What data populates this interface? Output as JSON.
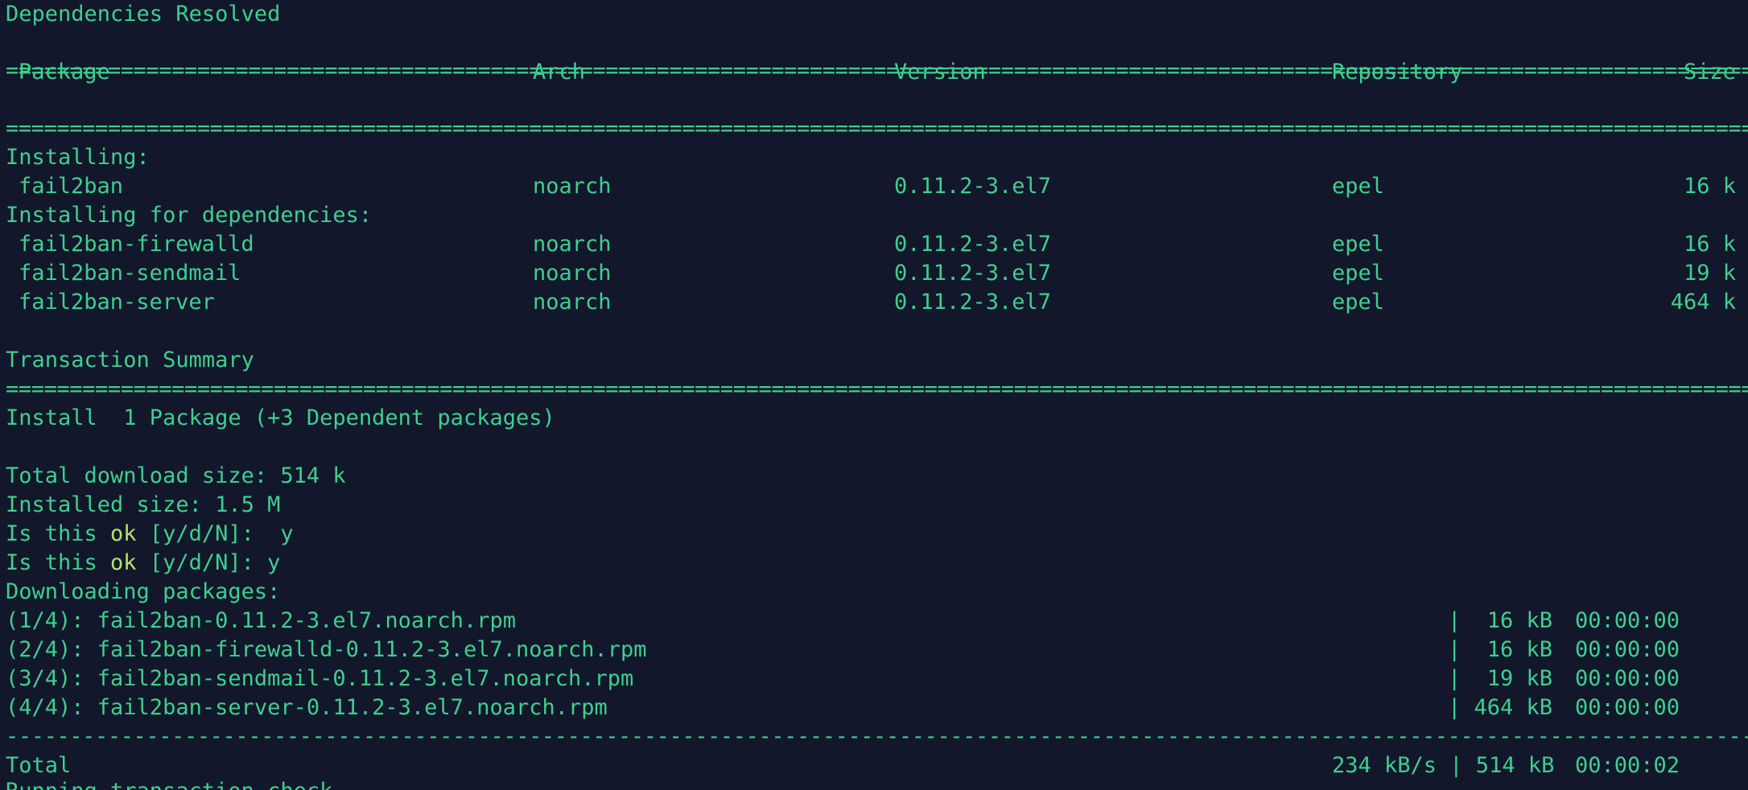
{
  "terminal": {
    "heading": "Dependencies Resolved",
    "table_header": {
      "package": "Package",
      "arch": "Arch",
      "version": "Version",
      "repository": "Repository",
      "size": "Size"
    },
    "installing_label": "Installing:",
    "installing": [
      {
        "name": "fail2ban",
        "arch": "noarch",
        "version": "0.11.2-3.el7",
        "repo": "epel",
        "size": "16 k"
      }
    ],
    "deps_label": "Installing for dependencies:",
    "dependencies": [
      {
        "name": "fail2ban-firewalld",
        "arch": "noarch",
        "version": "0.11.2-3.el7",
        "repo": "epel",
        "size": "16 k"
      },
      {
        "name": "fail2ban-sendmail",
        "arch": "noarch",
        "version": "0.11.2-3.el7",
        "repo": "epel",
        "size": "19 k"
      },
      {
        "name": "fail2ban-server",
        "arch": "noarch",
        "version": "0.11.2-3.el7",
        "repo": "epel",
        "size": "464 k"
      }
    ],
    "summary_title": "Transaction Summary",
    "install_line": "Install  1 Package (+3 Dependent packages)",
    "total_download": "Total download size: 514 k",
    "installed_size": "Installed size: 1.5 M",
    "prompt1": {
      "prefix": "Is this ",
      "ok": "ok",
      "suffix": " [y/d/N]:  y"
    },
    "prompt2": {
      "prefix": "Is this ",
      "ok": "ok",
      "suffix": " [y/d/N]: y"
    },
    "downloading_label": "Downloading packages:",
    "downloads": [
      {
        "file": "(1/4): fail2ban-0.11.2-3.el7.noarch.rpm",
        "size": "|  16 kB",
        "time": "00:00:00"
      },
      {
        "file": "(2/4): fail2ban-firewalld-0.11.2-3.el7.noarch.rpm",
        "size": "|  16 kB",
        "time": "00:00:00"
      },
      {
        "file": "(3/4): fail2ban-sendmail-0.11.2-3.el7.noarch.rpm",
        "size": "|  19 kB",
        "time": "00:00:00"
      },
      {
        "file": "(4/4): fail2ban-server-0.11.2-3.el7.noarch.rpm",
        "size": "| 464 kB",
        "time": "00:00:00"
      }
    ],
    "total": {
      "label": "Total",
      "rate": "234 kB/s | 514 kB",
      "time": "00:00:02"
    },
    "cut_line": "Running transaction check"
  },
  "colors": {
    "background": "#12172b",
    "text": "#3ecf8e",
    "highlight": "#b5e36a"
  }
}
